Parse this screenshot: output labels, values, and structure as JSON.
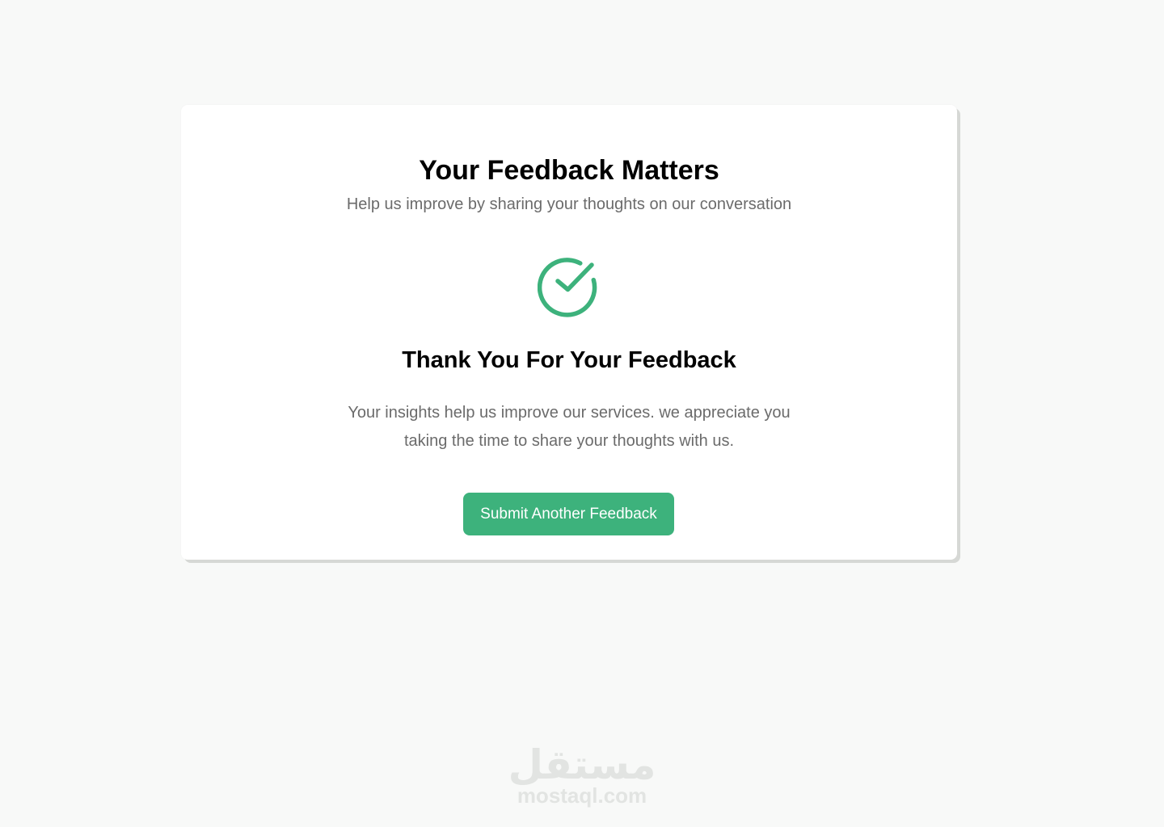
{
  "card": {
    "title": "Your Feedback Matters",
    "subtitle": "Help us improve by sharing your thoughts on our conversation",
    "icon": "check-circle-icon",
    "thanks_title": "Thank You For Your Feedback",
    "message": "Your insights help us improve our services. we appreciate you taking the time to share your thoughts with us.",
    "button_label": "Submit Another Feedback"
  },
  "watermark": {
    "arabic": "مستقل",
    "domain": "mostaql.com"
  },
  "colors": {
    "accent": "#3db27c",
    "background": "#f8f9f8",
    "card": "#ffffff",
    "text_primary": "#000000",
    "text_secondary": "#6b6b6b"
  }
}
